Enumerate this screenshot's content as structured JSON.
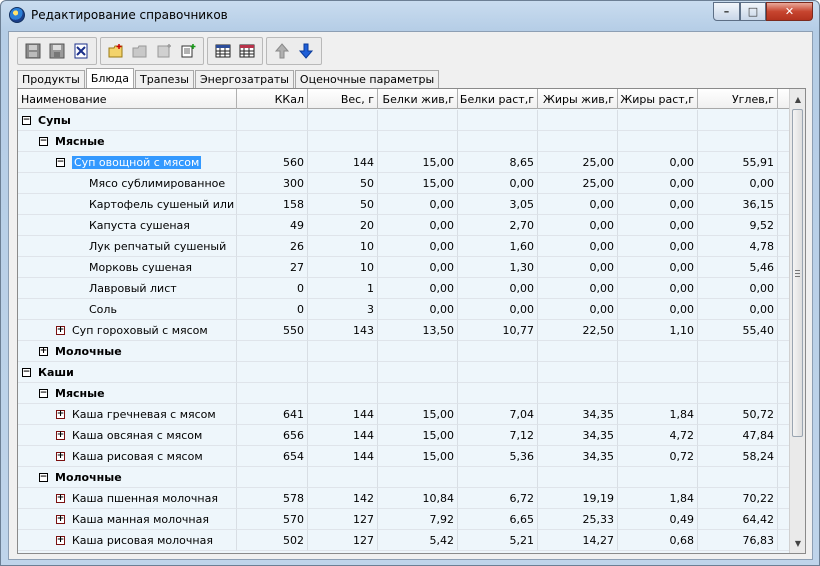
{
  "window": {
    "title": "Редактирование справочников",
    "controls": {
      "minimize": "–",
      "maximize": "□",
      "close": "✕"
    }
  },
  "toolbar": {
    "groups": [
      [
        "save-disk-icon",
        "save-as-icon",
        "cancel-x-icon"
      ],
      [
        "folder-add-icon",
        "item-add-disabled-icon",
        "subitem-add-disabled-icon",
        "record-add-icon"
      ],
      [
        "table-icon",
        "table-edit-icon"
      ],
      [
        "arrow-up-icon",
        "arrow-down-icon"
      ]
    ]
  },
  "tabs": [
    {
      "label": "Продукты",
      "active": false
    },
    {
      "label": "Блюда",
      "active": true
    },
    {
      "label": "Трапезы",
      "active": false
    },
    {
      "label": "Энергозатраты",
      "active": false
    },
    {
      "label": "Оценочные параметры",
      "active": false
    }
  ],
  "grid": {
    "columns": [
      "Наименование",
      "ККал",
      "Вес, г",
      "Белки жив,г",
      "Белки раст,г",
      "Жиры жив,г",
      "Жиры раст,г",
      "Углев,г"
    ],
    "rows": [
      {
        "level": 0,
        "expander": "minus",
        "bold": true,
        "name": "Супы",
        "values": [
          "",
          "",
          "",
          "",
          "",
          "",
          ""
        ]
      },
      {
        "level": 1,
        "expander": "minus",
        "bold": true,
        "name": "Мясные",
        "values": [
          "",
          "",
          "",
          "",
          "",
          "",
          ""
        ]
      },
      {
        "level": 2,
        "expander": "minus",
        "bold": false,
        "selected": true,
        "name": "Суп овощной с мясом",
        "values": [
          "560",
          "144",
          "15,00",
          "8,65",
          "25,00",
          "0,00",
          "55,91"
        ]
      },
      {
        "level": 3,
        "expander": "",
        "bold": false,
        "name": "Мясо сублимированное",
        "values": [
          "300",
          "50",
          "15,00",
          "0,00",
          "25,00",
          "0,00",
          "0,00"
        ]
      },
      {
        "level": 3,
        "expander": "",
        "bold": false,
        "name": "Картофель сушеный или к...",
        "values": [
          "158",
          "50",
          "0,00",
          "3,05",
          "0,00",
          "0,00",
          "36,15"
        ]
      },
      {
        "level": 3,
        "expander": "",
        "bold": false,
        "name": "Капуста сушеная",
        "values": [
          "49",
          "20",
          "0,00",
          "2,70",
          "0,00",
          "0,00",
          "9,52"
        ]
      },
      {
        "level": 3,
        "expander": "",
        "bold": false,
        "name": "Лук репчатый сушеный",
        "values": [
          "26",
          "10",
          "0,00",
          "1,60",
          "0,00",
          "0,00",
          "4,78"
        ]
      },
      {
        "level": 3,
        "expander": "",
        "bold": false,
        "name": "Морковь сушеная",
        "values": [
          "27",
          "10",
          "0,00",
          "1,30",
          "0,00",
          "0,00",
          "5,46"
        ]
      },
      {
        "level": 3,
        "expander": "",
        "bold": false,
        "name": "Лавровый лист",
        "values": [
          "0",
          "1",
          "0,00",
          "0,00",
          "0,00",
          "0,00",
          "0,00"
        ]
      },
      {
        "level": 3,
        "expander": "",
        "bold": false,
        "name": "Соль",
        "values": [
          "0",
          "3",
          "0,00",
          "0,00",
          "0,00",
          "0,00",
          "0,00"
        ]
      },
      {
        "level": 2,
        "expander": "plus",
        "bold": false,
        "name": "Суп гороховый с мясом",
        "values": [
          "550",
          "143",
          "13,50",
          "10,77",
          "22,50",
          "1,10",
          "55,40"
        ]
      },
      {
        "level": 1,
        "expander": "plus",
        "bold": true,
        "name": "Молочные",
        "values": [
          "",
          "",
          "",
          "",
          "",
          "",
          ""
        ]
      },
      {
        "level": 0,
        "expander": "minus",
        "bold": true,
        "name": "Каши",
        "values": [
          "",
          "",
          "",
          "",
          "",
          "",
          ""
        ]
      },
      {
        "level": 1,
        "expander": "minus",
        "bold": true,
        "name": "Мясные",
        "values": [
          "",
          "",
          "",
          "",
          "",
          "",
          ""
        ]
      },
      {
        "level": 2,
        "expander": "plus",
        "bold": false,
        "name": "Каша гречневая с мясом",
        "values": [
          "641",
          "144",
          "15,00",
          "7,04",
          "34,35",
          "1,84",
          "50,72"
        ]
      },
      {
        "level": 2,
        "expander": "plus",
        "bold": false,
        "name": "Каша овсяная с мясом",
        "values": [
          "656",
          "144",
          "15,00",
          "7,12",
          "34,35",
          "4,72",
          "47,84"
        ]
      },
      {
        "level": 2,
        "expander": "plus",
        "bold": false,
        "name": "Каша рисовая с мясом",
        "values": [
          "654",
          "144",
          "15,00",
          "5,36",
          "34,35",
          "0,72",
          "58,24"
        ]
      },
      {
        "level": 1,
        "expander": "minus",
        "bold": true,
        "name": "Молочные",
        "values": [
          "",
          "",
          "",
          "",
          "",
          "",
          ""
        ]
      },
      {
        "level": 2,
        "expander": "plus",
        "bold": false,
        "name": "Каша пшенная молочная",
        "values": [
          "578",
          "142",
          "10,84",
          "6,72",
          "19,19",
          "1,84",
          "70,22"
        ]
      },
      {
        "level": 2,
        "expander": "plus",
        "bold": false,
        "name": "Каша манная молочная",
        "values": [
          "570",
          "127",
          "7,92",
          "6,65",
          "25,33",
          "0,49",
          "64,42"
        ]
      },
      {
        "level": 2,
        "expander": "plus",
        "bold": false,
        "name": "Каша рисовая молочная",
        "values": [
          "502",
          "127",
          "5,42",
          "5,21",
          "14,27",
          "0,68",
          "76,83"
        ]
      }
    ]
  },
  "scrollbar": {
    "up": "▲",
    "down": "▼"
  }
}
